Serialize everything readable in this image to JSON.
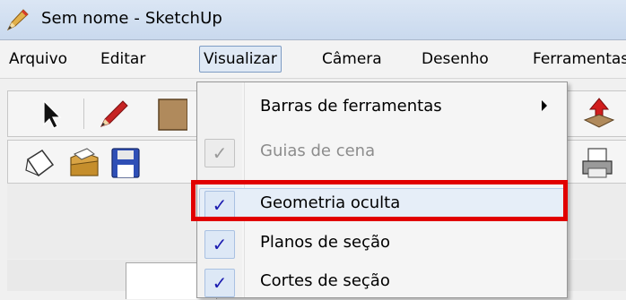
{
  "window": {
    "title": "Sem nome - SketchUp",
    "app_icon": "sketchup-pencil-icon"
  },
  "menubar": {
    "items": [
      {
        "label": "Arquivo"
      },
      {
        "label": "Editar"
      },
      {
        "label": "Visualizar",
        "open": true
      },
      {
        "label": "Câmera"
      },
      {
        "label": "Desenho"
      },
      {
        "label": "Ferramentas"
      }
    ]
  },
  "toolbar": {
    "row1_icons": [
      "select-arrow-icon",
      "pencil-icon",
      "rectangle-icon",
      "push-pull-icon"
    ],
    "row2_icons": [
      "new-document-icon",
      "open-folder-icon",
      "save-floppy-icon",
      "print-icon"
    ]
  },
  "dropdown": {
    "items": [
      {
        "label": "Barras de ferramentas",
        "submenu": true,
        "checked": false,
        "enabled": true
      },
      {
        "label": "Guias de cena",
        "checked": true,
        "enabled": false
      },
      {
        "label": "Geometria oculta",
        "checked": true,
        "enabled": true,
        "highlighted": true
      },
      {
        "label": "Planos de seção",
        "checked": true,
        "enabled": true
      },
      {
        "label": "Cortes de seção",
        "checked": true,
        "enabled": true
      }
    ],
    "check_glyph": "✓"
  },
  "colors": {
    "highlight_border": "#e10000",
    "check_color": "#1b1bb0"
  }
}
